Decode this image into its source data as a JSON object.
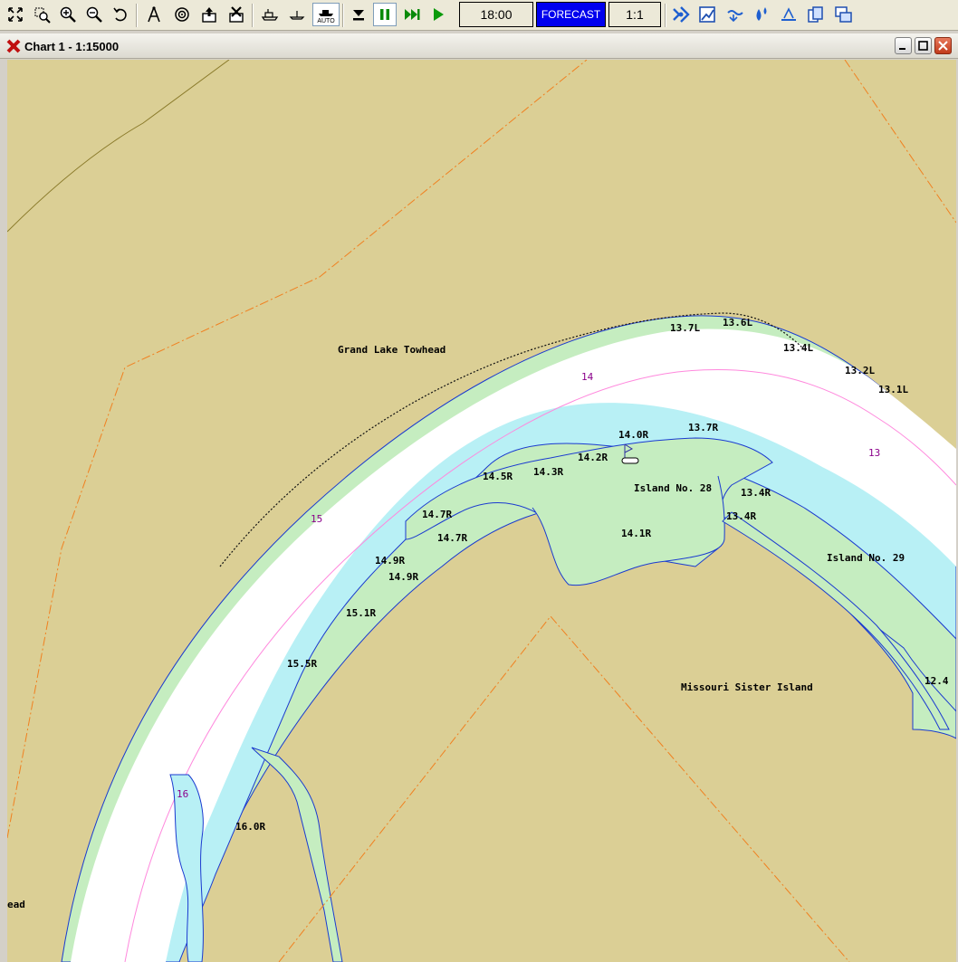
{
  "toolbar": {
    "time": "18:00",
    "forecast": "FORECAST",
    "scale": "1:1",
    "auto_label": "AUTO"
  },
  "window": {
    "title": "Chart 1 - 1:15000"
  },
  "map": {
    "place_labels": [
      {
        "name": "grand-lake-towhead",
        "text": "Grand Lake Towhead"
      },
      {
        "name": "island-no-28",
        "text": "Island No. 28"
      },
      {
        "name": "island-no-29",
        "text": "Island No. 29"
      },
      {
        "name": "missouri-sister-island",
        "text": "Missouri Sister Island"
      },
      {
        "name": "towhead-partial",
        "text": "ead"
      }
    ],
    "mile_markers": [
      "14",
      "13",
      "15",
      "16"
    ],
    "light_labels": [
      "13.7L",
      "13.6L",
      "13.4L",
      "13.2L",
      "13.1L",
      "14.0R",
      "13.7R",
      "14.2R",
      "14.3R",
      "14.5R",
      "13.4R",
      "13.4R",
      "14.7R",
      "14.7R",
      "14.1R",
      "14.9R",
      "14.9R",
      "15.1R",
      "15.5R",
      "16.0R",
      "12.4"
    ],
    "colors": {
      "land": "#dbcf95",
      "shallow": "#c5edc0",
      "water": "#b8f0f5",
      "channel": "#ffffff",
      "shore": "#1a3ad0",
      "mile_label": "#8b008b"
    }
  }
}
